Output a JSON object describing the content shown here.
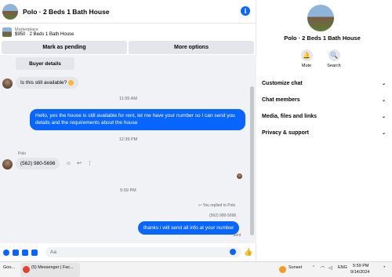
{
  "header": {
    "title": "Polo · 2 Beds 1 Bath House",
    "info_glyph": "i"
  },
  "listing": {
    "label": "Marketplace",
    "price_title": "$950 · 2 Beds 1 Bath House"
  },
  "actions": {
    "mark_pending": "Mark as pending",
    "more_options": "More options"
  },
  "messages": {
    "buyer_details": "Buyer details",
    "available_question": "Is this still available?",
    "ts1": "11:55 AM",
    "reply1": "Hello, yes the house is still available for rent, let me have your number so I can send you details and the requirements about the house",
    "ts2": "12:39 PM",
    "sender_name": "Polo",
    "phone": "(562) 980-5696",
    "ts3": "5:59 PM",
    "replied_to": "You replied to Polo",
    "quoted_phone": "(562) 980-5696",
    "reply2": "thanks i will send all info at your number",
    "sent_status": "Sent"
  },
  "composer": {
    "placeholder": "Aa"
  },
  "panel": {
    "name": "Polo · 2 Beds 1 Bath House",
    "mute_label": "Mute",
    "search_label": "Search",
    "rows": [
      "Customize chat",
      "Chat members",
      "Media, files and links",
      "Privacy & support"
    ]
  },
  "taskbar": {
    "item1": "Goo...",
    "item2": "(5) Messenger | Fac...",
    "weather": "Sunset",
    "lang": "ENG",
    "time": "5:59 PM",
    "date": "9/14/2024"
  },
  "colors": {
    "accent": "#0866ff",
    "bubble_gray": "#e4e6eb",
    "bg_chat": "#f0f2f5"
  }
}
